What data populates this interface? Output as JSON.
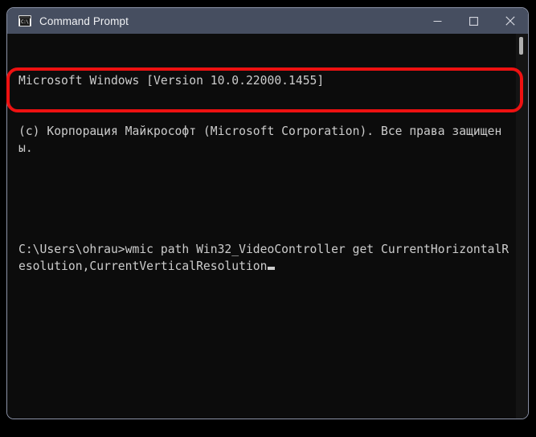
{
  "window": {
    "title": "Command Prompt",
    "icon": "console-icon",
    "icon_glyph": "C:\\",
    "controls": [
      {
        "name": "minimize-button",
        "label": "Minimize",
        "glyph": "minimize-icon"
      },
      {
        "name": "maximize-button",
        "label": "Maximize",
        "glyph": "maximize-icon"
      },
      {
        "name": "close-button",
        "label": "Close",
        "glyph": "close-icon"
      }
    ]
  },
  "terminal": {
    "lines": [
      "Microsoft Windows [Version 10.0.22000.1455]",
      "(c) Корпорация Майкрософт (Microsoft Corporation). Все права защищены.",
      ""
    ],
    "prompt": "C:\\Users\\ohrau>",
    "command": "wmic path Win32_VideoController get CurrentHorizontalResolution,CurrentVerticalResolution",
    "cursor": "block-cursor"
  },
  "annotation": {
    "name": "red-highlight-box",
    "color": "#ee1111",
    "target": "command-line"
  },
  "colors": {
    "desktop_background": "#000000",
    "title_bar": "#464e60",
    "terminal_background": "#0c0c0c",
    "terminal_text": "#cccccc",
    "window_border": "#8c93a8",
    "highlight": "#ee1111"
  }
}
